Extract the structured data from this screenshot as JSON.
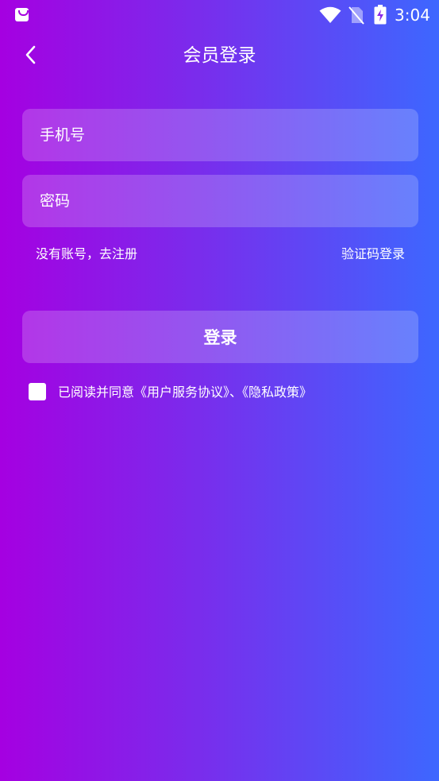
{
  "status_bar": {
    "time": "3:04",
    "icons": [
      "app-notification-icon",
      "wifi-icon",
      "no-sim-icon",
      "battery-charging-icon"
    ]
  },
  "header": {
    "title": "会员登录",
    "back_icon": "chevron-left-icon"
  },
  "form": {
    "phone_placeholder": "手机号",
    "password_placeholder": "密码",
    "register_link": "没有账号，去注册",
    "sms_login_link": "验证码登录",
    "login_button": "登录"
  },
  "agreement": {
    "checked": false,
    "text": "已阅读并同意《用户服务协议》、《隐私政策》"
  },
  "colors": {
    "gradient_start": "#a500e1",
    "gradient_end": "#3d67ff",
    "text": "#ffffff"
  }
}
